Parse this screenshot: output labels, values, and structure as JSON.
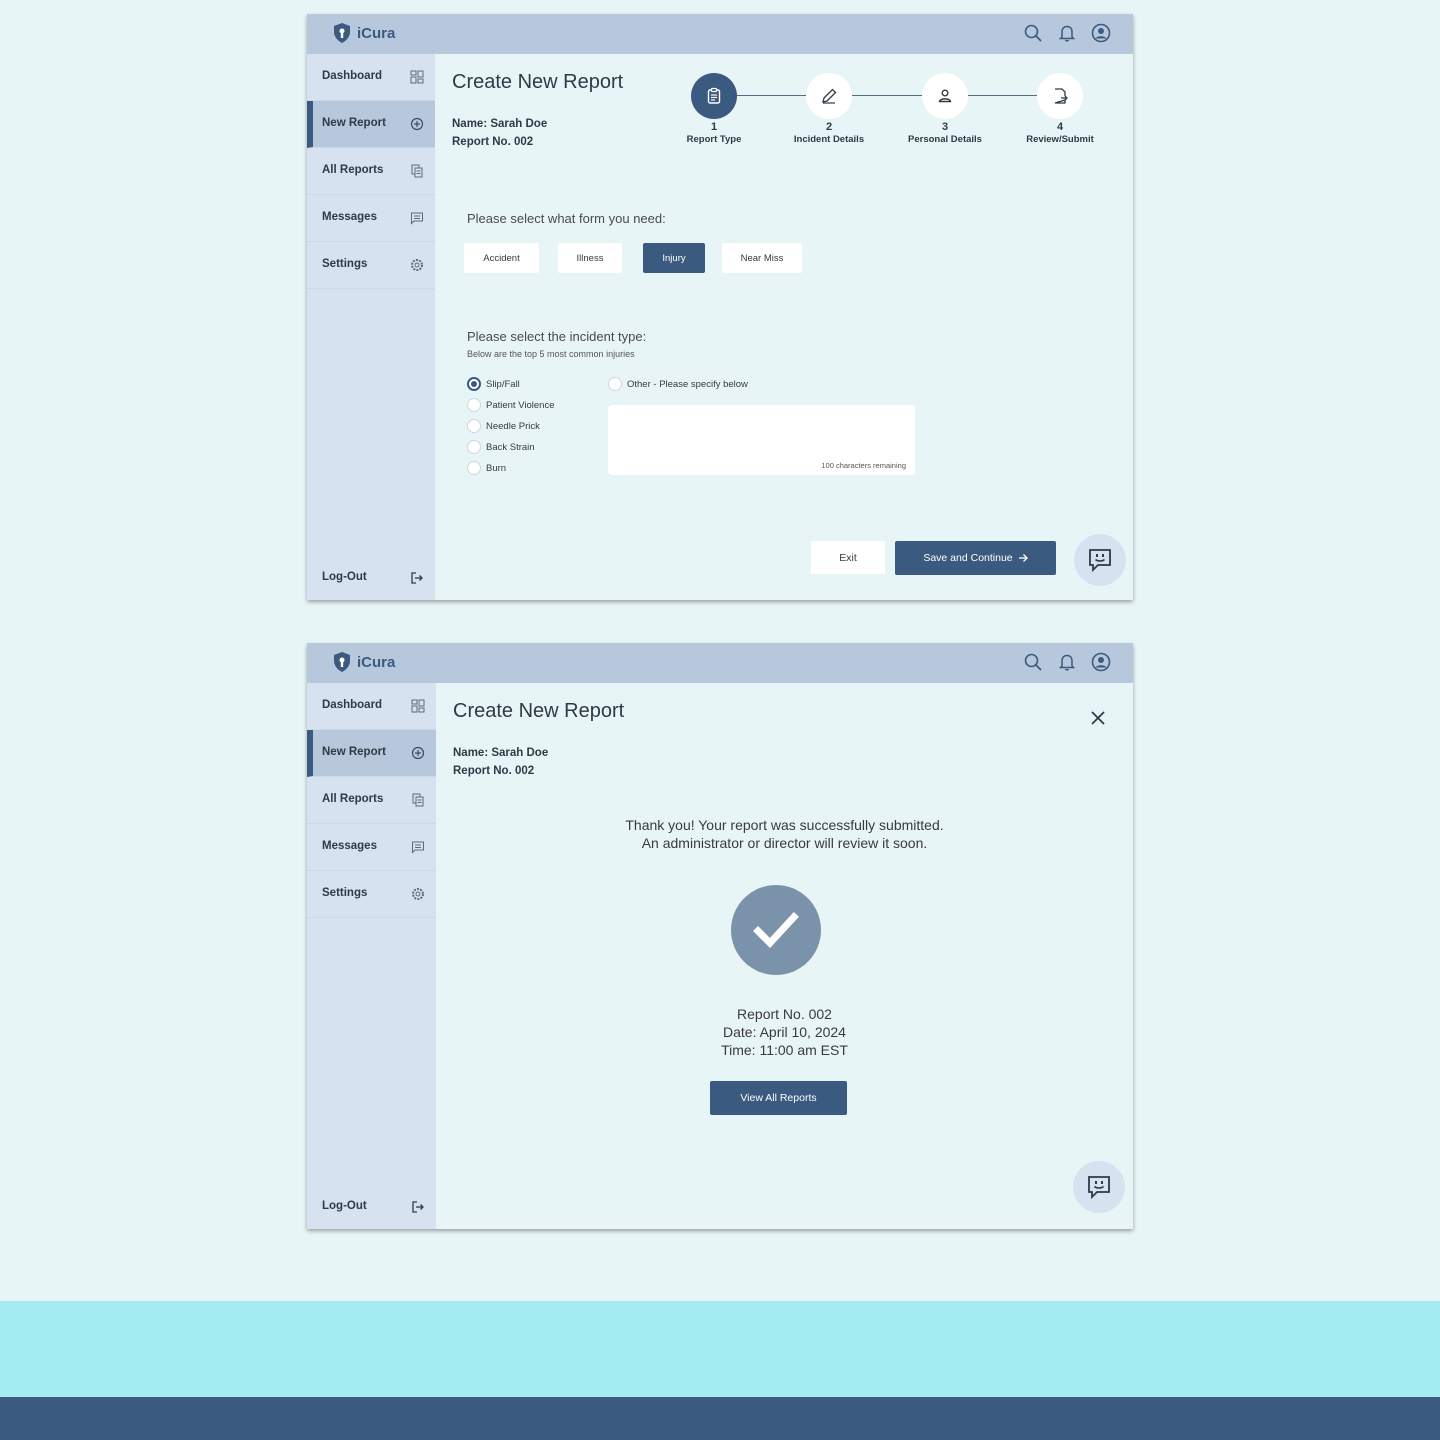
{
  "app": {
    "name": "iCura"
  },
  "nav": {
    "items": [
      {
        "label": "Dashboard",
        "icon": "dashboard-icon"
      },
      {
        "label": "New Report",
        "icon": "plus-circle-icon"
      },
      {
        "label": "All Reports",
        "icon": "documents-icon"
      },
      {
        "label": "Messages",
        "icon": "message-icon"
      },
      {
        "label": "Settings",
        "icon": "gear-icon"
      }
    ],
    "active": "New Report",
    "logout_label": "Log-Out"
  },
  "screen1": {
    "title": "Create New Report",
    "name_line": "Name: Sarah Doe",
    "report_line": "Report No. 002",
    "steps": [
      {
        "num": "1",
        "label": "Report Type",
        "icon": "clipboard-icon",
        "active": true
      },
      {
        "num": "2",
        "label": "Incident Details",
        "icon": "pencil-icon",
        "active": false
      },
      {
        "num": "3",
        "label": "Personal Details",
        "icon": "person-icon",
        "active": false
      },
      {
        "num": "4",
        "label": "Review/Submit",
        "icon": "document-export-icon",
        "active": false
      }
    ],
    "form_question": "Please select what form you need:",
    "form_options": [
      "Accident",
      "Illness",
      "Injury",
      "Near Miss"
    ],
    "form_selected": "Injury",
    "incident_question": "Please select the incident type:",
    "incident_note": "Below are the top 5 most common injuries",
    "incident_options": [
      "Slip/Fall",
      "Patient Violence",
      "Needle Prick",
      "Back Strain",
      "Burn"
    ],
    "incident_selected": "Slip/Fall",
    "other_label": "Other - Please specify below",
    "other_value": "",
    "char_count": "100 characters remaining",
    "exit_label": "Exit",
    "save_label": "Save and Continue"
  },
  "screen2": {
    "title": "Create New Report",
    "name_line": "Name: Sarah Doe",
    "report_line": "Report No. 002",
    "thanks_line1": "Thank you! Your report was successfully submitted.",
    "thanks_line2": "An administrator or director will review it soon.",
    "report_no": "Report No. 002",
    "date": "Date: April 10, 2024",
    "time": "Time: 11:00 am EST",
    "view_label": "View All Reports"
  },
  "colors": {
    "primary": "#3b5a7f",
    "topbar": "#b8c8dc",
    "sidebar": "#d7e2f0",
    "background": "#e8f5f6",
    "success": "#7a92aa",
    "band_cyan": "#a3edf2"
  }
}
